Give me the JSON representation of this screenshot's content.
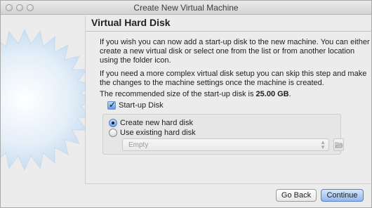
{
  "window": {
    "title": "Create New Virtual Machine"
  },
  "panel": {
    "title": "Virtual Hard Disk",
    "paragraph1": "If you wish you can now add a start-up disk to the new machine. You can either create a new virtual disk or select one from the list or from another location using the folder icon.",
    "paragraph2": "If you need a more complex virtual disk setup you can skip this step and make the changes to the machine settings once the machine is created.",
    "recommended_prefix": "The recommended size of the start-up disk is ",
    "recommended_size": "25.00 GB",
    "recommended_suffix": "."
  },
  "startup_disk": {
    "label": "Start-up Disk",
    "checked": true
  },
  "disk_options": {
    "create_new_label": "Create new hard disk",
    "use_existing_label": "Use existing hard disk",
    "selected": "create_new"
  },
  "existing_disk_select": {
    "value": "Empty"
  },
  "buttons": {
    "back_label": "Go Back",
    "continue_label": "Continue"
  },
  "icons": {
    "checkmark": "checkmark-icon",
    "folder": "folder-icon",
    "select_arrows": "updown-arrows-icon",
    "background": "star-burst-watermark"
  },
  "colors": {
    "accent": "#5b9be7",
    "default_button": "#8fb9ef",
    "star_fill": "#d8e7f5"
  }
}
